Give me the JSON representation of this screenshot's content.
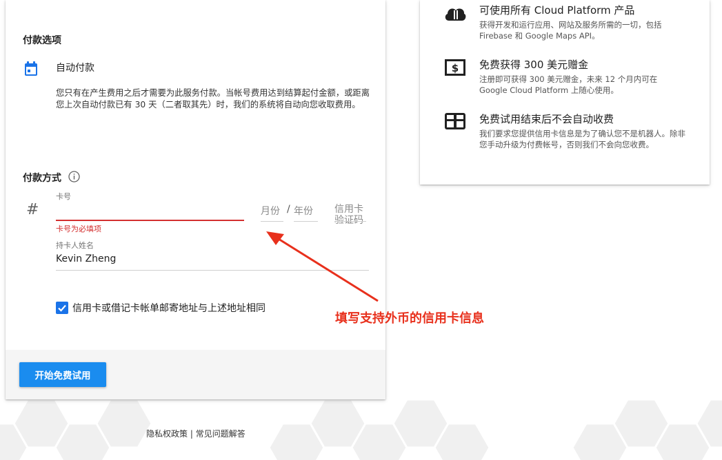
{
  "payment_options": {
    "title": "付款选项",
    "auto_pay_label": "自动付款",
    "auto_pay_desc": "您只有在产生费用之后才需要为此服务付款。当帐号费用达到结算起付金额，或距离您上次自动付款已有 30 天（二者取其先）时，我们的系统将自动向您收取费用。"
  },
  "payment_method": {
    "title": "付款方式",
    "card_number_label": "卡号",
    "card_number_value": "",
    "card_number_error": "卡号为必填项",
    "month_placeholder": "月份",
    "separator": "/",
    "year_placeholder": "年份",
    "cvc_placeholder": "信用卡验证码",
    "cardholder_label": "持卡人姓名",
    "cardholder_value": "Kevin Zheng",
    "same_address_label": "信用卡或借记卡帐单邮寄地址与上述地址相同",
    "same_address_checked": true
  },
  "start_button_label": "开始免费试用",
  "benefits": [
    {
      "icon": "cloud-icon",
      "title": "可使用所有 Cloud Platform 产品",
      "desc": "获得开发和运行应用、网站及服务所需的一切，包括 Firebase 和 Google Maps API。"
    },
    {
      "icon": "dollar-icon",
      "title": "免费获得 300 美元赠金",
      "desc": "注册即可获得 300 美元赠金，未来 12 个月内可在 Google Cloud Platform 上随心使用。"
    },
    {
      "icon": "no-charge-icon",
      "title": "免费试用结束后不会自动收费",
      "desc": "我们要求您提供信用卡信息是为了确认您不是机器人。除非您手动升级为付费帐号，否则我们不会向您收费。"
    }
  ],
  "annotation_text": "填写支持外币的信用卡信息",
  "footer": {
    "privacy": "隐私权政策",
    "separator": "|",
    "faq": "常见问题解答"
  },
  "colors": {
    "accent": "#1a8cef",
    "error": "#d32f2f",
    "annotation": "#e8301c",
    "checkbox": "#1a73e8"
  }
}
